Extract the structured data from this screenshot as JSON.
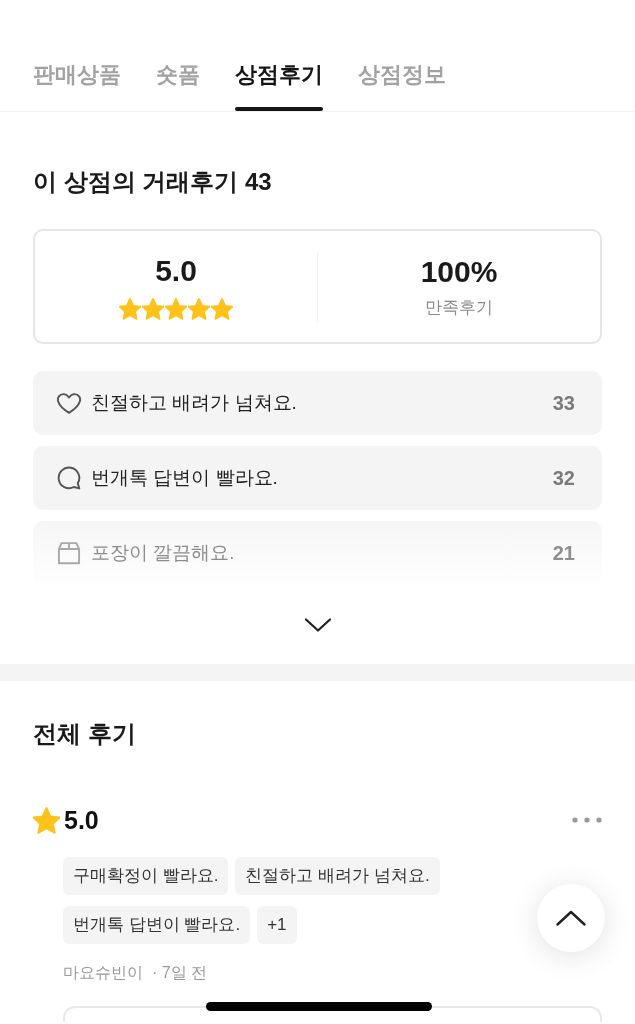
{
  "tabs": [
    {
      "label": "판매상품",
      "selected": false
    },
    {
      "label": "숏폼",
      "selected": false
    },
    {
      "label": "상점후기",
      "selected": true
    },
    {
      "label": "상점정보",
      "selected": false
    }
  ],
  "store_reviews": {
    "title": "이 상점의 거래후기 43",
    "rating": "5.0",
    "stars": 5,
    "satisfaction": "100%",
    "satisfaction_label": "만족후기"
  },
  "keyword_list": {
    "expanded": false,
    "items": [
      {
        "kind": "heart",
        "label": "친절하고 배려가 넘쳐요.",
        "count": "33"
      },
      {
        "kind": "chat",
        "label": "번개톡 답변이 빨라요.",
        "count": "32"
      },
      {
        "kind": "box",
        "label": "포장이 깔끔해요.",
        "count": "21"
      }
    ]
  },
  "all_reviews": {
    "title": "전체 후기",
    "items": [
      {
        "rating": "5.0",
        "tags": [
          "구매확정이 빨라요.",
          "친절하고 배려가 넘쳐요.",
          "번개톡 답변이 빨라요."
        ],
        "more_tags": "+1",
        "author": "마요슈빈이",
        "time": "· 7일 전"
      }
    ]
  }
}
